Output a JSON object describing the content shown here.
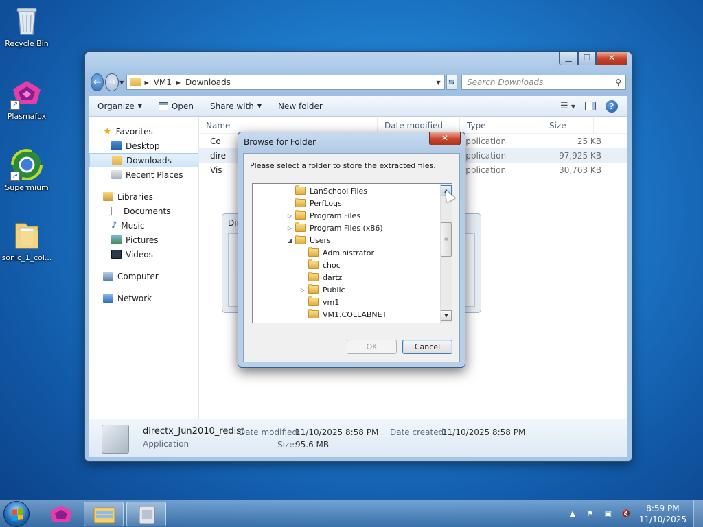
{
  "desktop": {
    "icons": [
      {
        "label": "Recycle Bin"
      },
      {
        "label": "Plasmafox"
      },
      {
        "label": "Supermium"
      },
      {
        "label": "sonic_1_col..."
      }
    ]
  },
  "explorer": {
    "breadcrumb": [
      "VM1",
      "Downloads"
    ],
    "search_placeholder": "Search Downloads",
    "toolbar": {
      "organize": "Organize",
      "open": "Open",
      "share_with": "Share with",
      "new_folder": "New folder"
    },
    "nav": {
      "favorites": "Favorites",
      "desktop": "Desktop",
      "downloads": "Downloads",
      "recent_places": "Recent Places",
      "libraries": "Libraries",
      "documents": "Documents",
      "music": "Music",
      "pictures": "Pictures",
      "videos": "Videos",
      "computer": "Computer",
      "network": "Network"
    },
    "columns": {
      "name": "Name",
      "date_modified": "Date modified",
      "type": "Type",
      "size": "Size"
    },
    "files": [
      {
        "name": "Co",
        "type": "Application",
        "size": "25 KB"
      },
      {
        "name": "dire",
        "type": "Application",
        "size": "97,925 KB"
      },
      {
        "name": "Vis",
        "type": "Application",
        "size": "30,763 KB"
      }
    ],
    "details": {
      "name": "directx_Jun2010_redist",
      "type": "Application",
      "date_modified_label": "Date modified:",
      "date_modified": "11/10/2025 8:58 PM",
      "date_created_label": "Date created:",
      "date_created": "11/10/2025 8:58 PM",
      "size_label": "Size:",
      "size": "95.6 MB"
    }
  },
  "ghost_dialog": {
    "title": "Dir"
  },
  "browse_dialog": {
    "title": "Browse for Folder",
    "message": "Please select a folder to store the extracted files.",
    "tree": [
      {
        "label": "LanSchool Files",
        "expander": ""
      },
      {
        "label": "PerfLogs",
        "expander": ""
      },
      {
        "label": "Program Files",
        "expander": "▷"
      },
      {
        "label": "Program Files (x86)",
        "expander": "▷"
      },
      {
        "label": "Users",
        "expander": "◢"
      },
      {
        "label": "Administrator",
        "expander": ""
      },
      {
        "label": "choc",
        "expander": ""
      },
      {
        "label": "dartz",
        "expander": ""
      },
      {
        "label": "Public",
        "expander": "▷"
      },
      {
        "label": "vm1",
        "expander": ""
      },
      {
        "label": "VM1.COLLABNET",
        "expander": ""
      }
    ],
    "ok_label": "OK",
    "cancel_label": "Cancel"
  },
  "taskbar": {
    "time": "8:59 PM",
    "date": "11/10/2025"
  }
}
